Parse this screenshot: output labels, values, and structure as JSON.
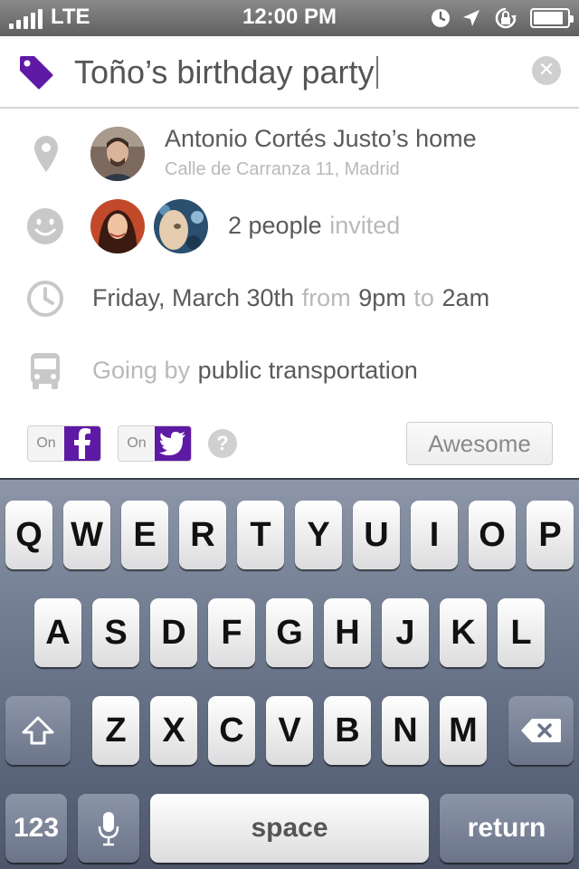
{
  "status_bar": {
    "carrier": "LTE",
    "time": "12:00 PM",
    "icons": [
      "signal-bars-icon",
      "alarm-clock-icon",
      "location-arrow-icon",
      "rotation-lock-icon",
      "battery-icon"
    ],
    "battery_level_pct": 90
  },
  "event": {
    "title": "Toño’s birthday party",
    "tag_icon": "price-tag-icon",
    "clear_icon": "clear-icon"
  },
  "location": {
    "icon": "map-pin-icon",
    "name": "Antonio Cortés Justo’s home",
    "address": "Calle de Carranza 11, Madrid"
  },
  "invitees": {
    "icon": "smiley-icon",
    "count_text": "2 people",
    "suffix": "invited"
  },
  "schedule": {
    "icon": "clock-icon",
    "day": "Friday, March 30th",
    "from_word": "from",
    "start": "9pm",
    "to_word": "to",
    "end": "2am"
  },
  "transport": {
    "icon": "bus-icon",
    "prefix": "Going by",
    "mode": "public transportation"
  },
  "sharing": {
    "facebook": {
      "state": "On",
      "icon": "facebook-icon"
    },
    "twitter": {
      "state": "On",
      "icon": "twitter-bird-icon"
    },
    "help_label": "?",
    "submit_label": "Awesome"
  },
  "colors": {
    "accent": "#5e1aa5",
    "status_bar": "#6e6e6e",
    "muted_text": "#b9b9b9",
    "main_text": "#5a5a5a"
  },
  "keyboard": {
    "row1": [
      "Q",
      "W",
      "E",
      "R",
      "T",
      "Y",
      "U",
      "I",
      "O",
      "P"
    ],
    "row2": [
      "A",
      "S",
      "D",
      "F",
      "G",
      "H",
      "J",
      "K",
      "L"
    ],
    "row3": [
      "Z",
      "X",
      "C",
      "V",
      "B",
      "N",
      "M"
    ],
    "numbers_label": "123",
    "space_label": "space",
    "return_label": "return"
  }
}
